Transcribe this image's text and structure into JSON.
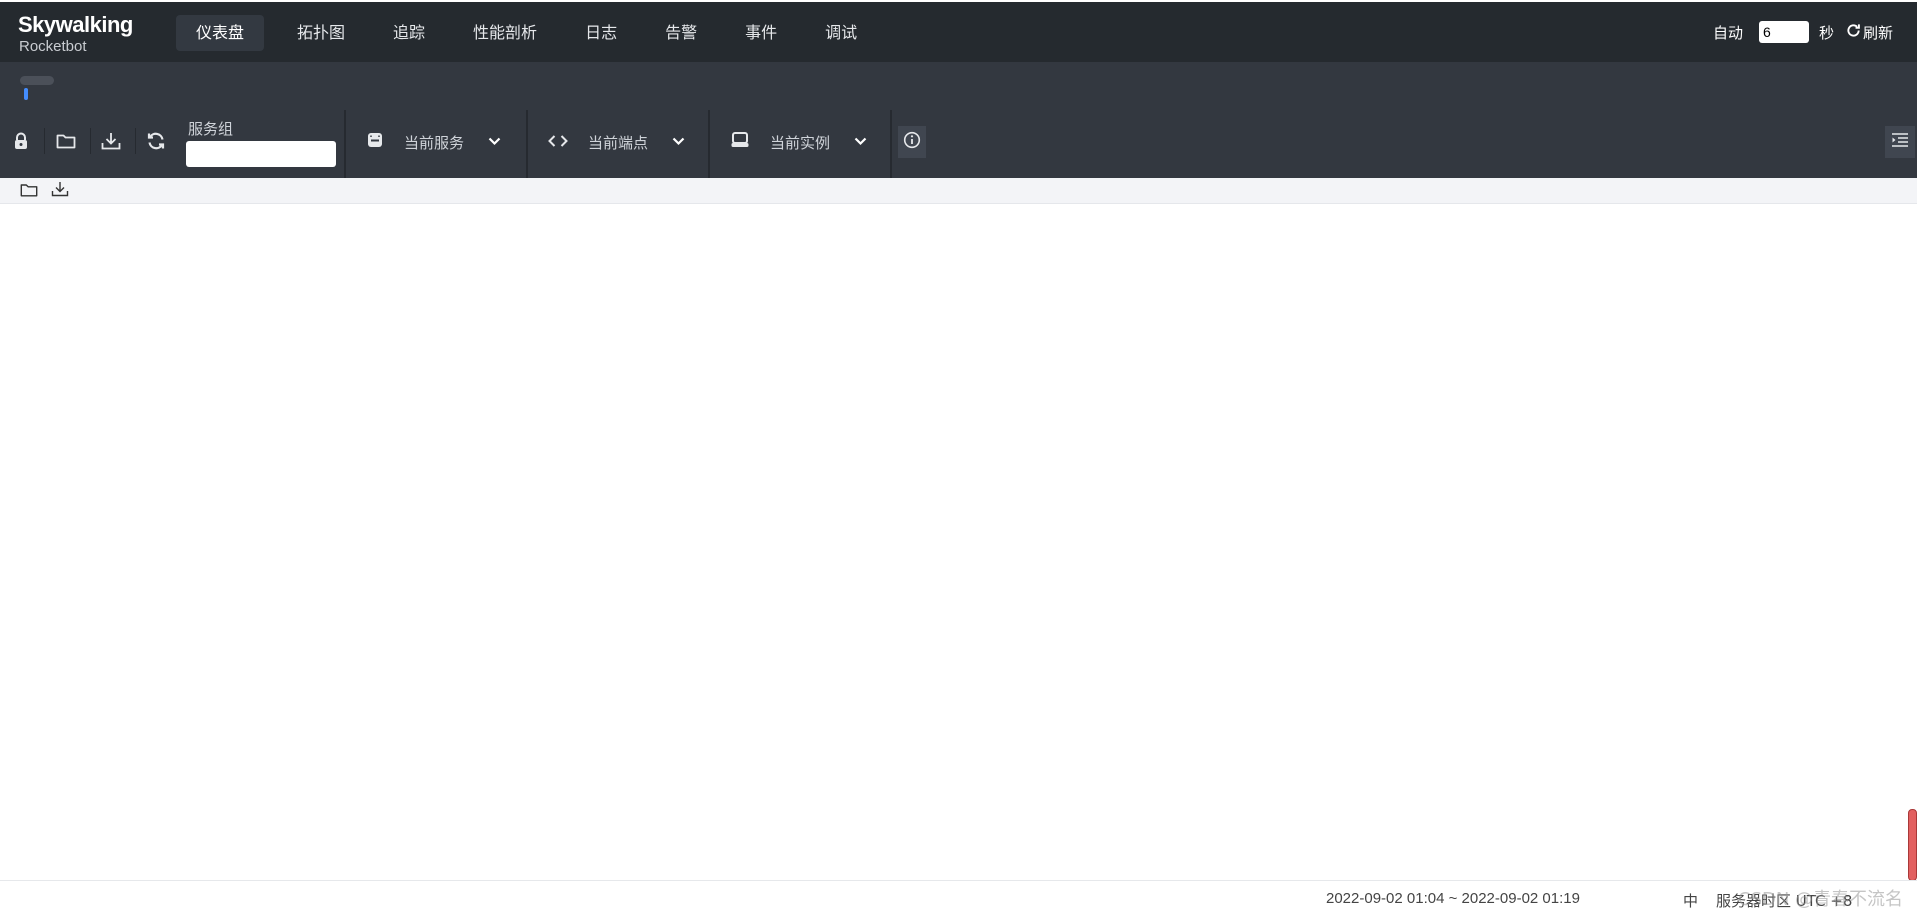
{
  "app": {
    "logo_main": "Skywalking",
    "logo_sub": "Rocketbot"
  },
  "nav": {
    "items": [
      {
        "label": "仪表盘",
        "active": true
      },
      {
        "label": "拓扑图"
      },
      {
        "label": "追踪"
      },
      {
        "label": "性能剖析"
      },
      {
        "label": "日志"
      },
      {
        "label": "告警"
      },
      {
        "label": "事件"
      },
      {
        "label": "调试"
      }
    ]
  },
  "auto_refresh": {
    "label": "自动",
    "interval_value": "6",
    "unit": "秒",
    "refresh_label": "刷新"
  },
  "toolbar": {
    "service_group_label": "服务组",
    "service_group_value": "",
    "current_service": "当前服务",
    "current_endpoint": "当前端点",
    "current_instance": "当前实例"
  },
  "footer": {
    "time_range": "2022-09-02 01:04 ~ 2022-09-02 01:19",
    "lang": "中",
    "server_zone": "服务器时区 UTC +8",
    "watermark": "CSDN @青春不流名"
  },
  "colors": {
    "topbar_bg": "#252a2f",
    "toolbar_bg": "#333840",
    "accent": "#448dfe",
    "scroll_handle": "#e26060"
  }
}
